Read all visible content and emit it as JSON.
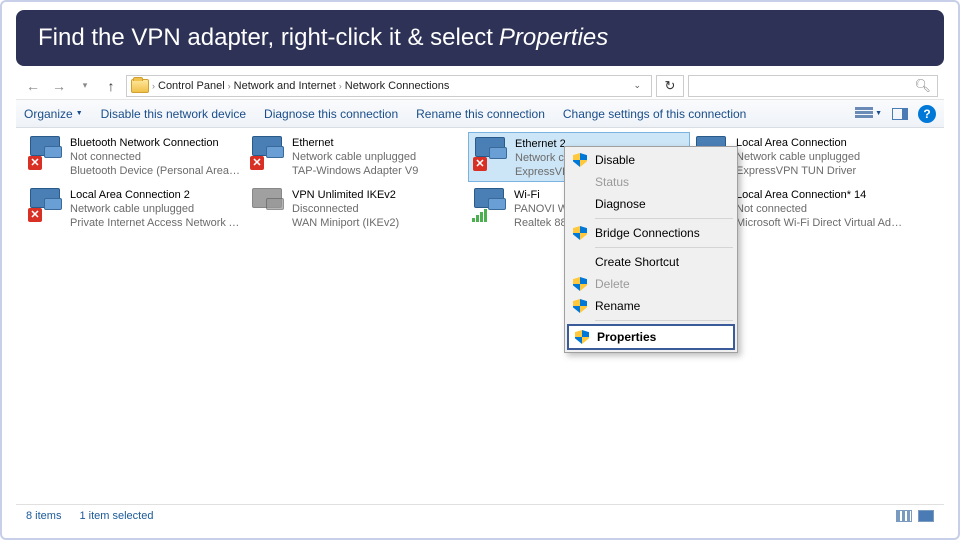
{
  "banner": {
    "prefix": "Find the VPN adapter, right-click it & select",
    "emphasis": "Properties"
  },
  "breadcrumbs": {
    "items": [
      "Control Panel",
      "Network and Internet",
      "Network Connections"
    ]
  },
  "toolbar": {
    "organize": "Organize",
    "disable": "Disable this network device",
    "diagnose": "Diagnose this connection",
    "rename": "Rename this connection",
    "change": "Change settings of this connection"
  },
  "connections": [
    {
      "name": "Bluetooth Network Connection",
      "status": "Not connected",
      "device": "Bluetooth Device (Personal Area ...",
      "icon": "bt",
      "error": true
    },
    {
      "name": "Ethernet",
      "status": "Network cable unplugged",
      "device": "TAP-Windows Adapter V9",
      "icon": "eth",
      "error": true
    },
    {
      "name": "Ethernet 2",
      "status": "Network cable unplugged",
      "device": "ExpressVPN TAP Adapter",
      "icon": "eth",
      "error": true,
      "selected": true
    },
    {
      "name": "Local Area Connection",
      "status": "Network cable unplugged",
      "device": "ExpressVPN TUN Driver",
      "icon": "eth",
      "error": true
    },
    {
      "name": "Local Area Connection 2",
      "status": "Network cable unplugged",
      "device": "Private Internet Access Network A...",
      "icon": "eth",
      "error": true
    },
    {
      "name": "VPN Unlimited IKEv2",
      "status": "Disconnected",
      "device": "WAN Miniport (IKEv2)",
      "icon": "gray",
      "error": false
    },
    {
      "name": "Wi-Fi",
      "status": "PANOVI WiFi",
      "device": "Realtek 8821CE Wireless LAN ...",
      "icon": "wifi",
      "error": false
    },
    {
      "name": "Local Area Connection* 14",
      "status": "Not connected",
      "device": "Microsoft Wi-Fi Direct Virtual Ada...",
      "icon": "gray",
      "error": true
    }
  ],
  "context_menu": {
    "disable": "Disable",
    "status": "Status",
    "diagnose": "Diagnose",
    "bridge": "Bridge Connections",
    "shortcut": "Create Shortcut",
    "delete": "Delete",
    "rename": "Rename",
    "properties": "Properties"
  },
  "statusbar": {
    "count": "8 items",
    "selected": "1 item selected"
  }
}
